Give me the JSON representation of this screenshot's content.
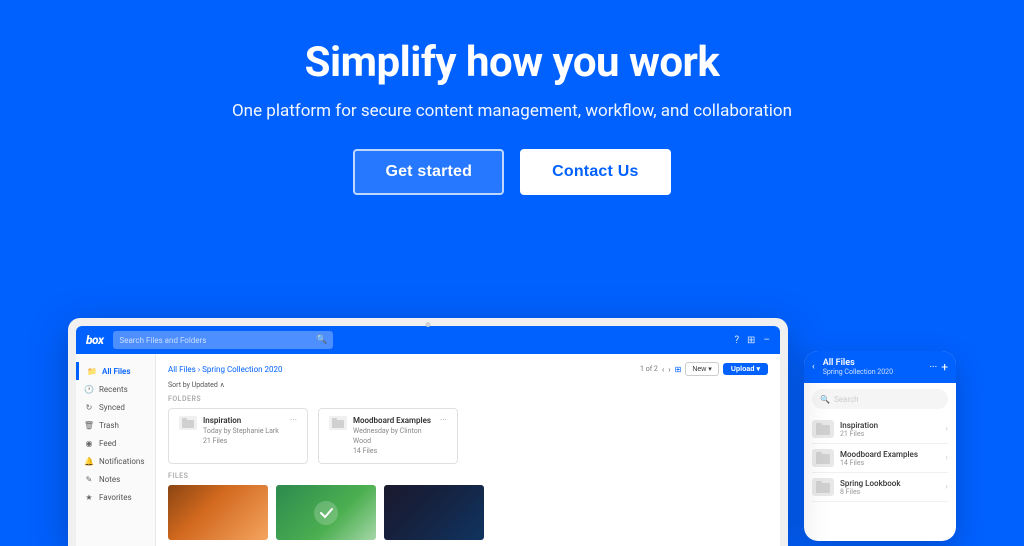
{
  "hero": {
    "title": "Simplify how you work",
    "subtitle": "One platform for secure content management, workflow, and collaboration",
    "btn_get_started": "Get started",
    "btn_contact": "Contact Us"
  },
  "app": {
    "logo": "box",
    "search_placeholder": "Search Files and Folders",
    "topbar_icons": [
      "?",
      "⊞",
      "–"
    ],
    "sidebar": {
      "items": [
        {
          "label": "All Files",
          "icon": "📁",
          "active": true
        },
        {
          "label": "Recents",
          "icon": "🕐",
          "active": false
        },
        {
          "label": "Synced",
          "icon": "↻",
          "active": false
        },
        {
          "label": "Trash",
          "icon": "🗑",
          "active": false
        },
        {
          "label": "Feed",
          "icon": "◉",
          "active": false
        },
        {
          "label": "Notifications",
          "icon": "🔔",
          "active": false
        },
        {
          "label": "Notes",
          "icon": "✎",
          "active": false
        },
        {
          "label": "Favorites",
          "icon": "★",
          "active": false
        }
      ]
    },
    "breadcrumb": "All Files › Spring Collection 2020",
    "page_info": "1 of 2",
    "btn_new": "New ▾",
    "btn_upload": "Upload ▾",
    "sort_label": "Sort by Updated ∧",
    "sections": {
      "folders_label": "FOLDERS",
      "files_label": "FILES"
    },
    "folders": [
      {
        "name": "Inspiration",
        "meta_line1": "Today by Stephanie Lark",
        "meta_line2": "21 Files"
      },
      {
        "name": "Moodboard Examples",
        "meta_line1": "Wednesday by Clinton Wood",
        "meta_line2": "14 Files"
      }
    ]
  },
  "phone": {
    "back_icon": "‹",
    "folder_label": "All Files",
    "collection_label": "Spring Collection 2020",
    "more_icon": "···",
    "plus_icon": "+",
    "search_placeholder": "Search",
    "items": [
      {
        "name": "Inspiration",
        "meta": "21 Files"
      },
      {
        "name": "Moodboard Examples",
        "meta": "14 Files"
      },
      {
        "name": "Spring Lookbook",
        "meta": "8 Files"
      }
    ]
  }
}
